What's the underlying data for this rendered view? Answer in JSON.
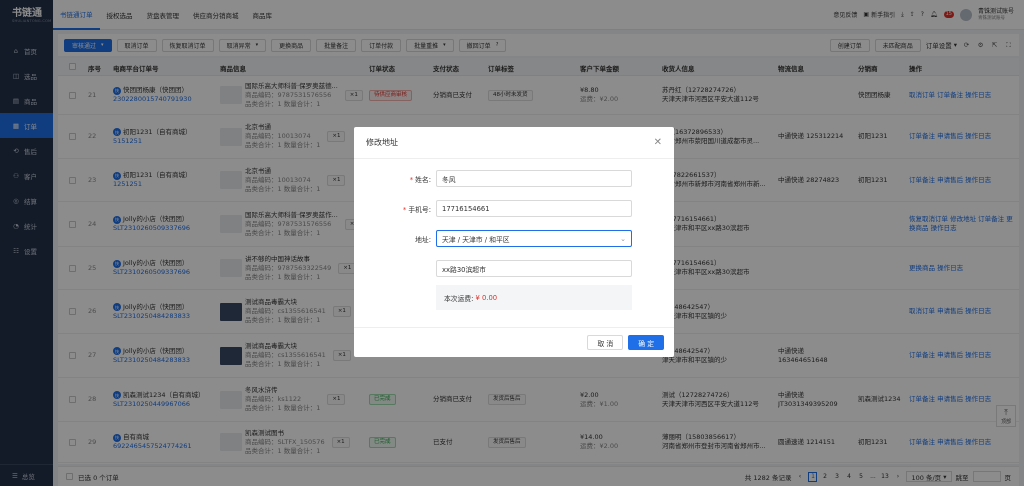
{
  "brand": {
    "title": "书链通",
    "subtitle": "SHULIANTONG.COM"
  },
  "sidebar": {
    "items": [
      {
        "label": "首页",
        "icon": "home-icon"
      },
      {
        "label": "选品",
        "icon": "select-icon"
      },
      {
        "label": "商品",
        "icon": "product-icon"
      },
      {
        "label": "订单",
        "icon": "order-icon",
        "active": true
      },
      {
        "label": "售后",
        "icon": "aftersale-icon"
      },
      {
        "label": "客户",
        "icon": "customer-icon"
      },
      {
        "label": "结算",
        "icon": "settle-icon"
      },
      {
        "label": "统计",
        "icon": "stats-icon"
      },
      {
        "label": "设置",
        "icon": "settings-icon"
      }
    ],
    "bottom": "总览"
  },
  "tabs": [
    "书链通订单",
    "授权选品",
    "货盘表管理",
    "供应商分销商城",
    "商品库"
  ],
  "header": {
    "feedback": "意见反馈",
    "guide": "新手指引",
    "badge": "15",
    "user_name": "青铢测试账号",
    "user_sub": "青铢测试账号"
  },
  "toolbar": {
    "buttons": [
      "审核通过",
      "取消订单",
      "恢复取消订单",
      "取消异常",
      "更换商品",
      "批量备注",
      "订单付款",
      "批量重推",
      "撤回订单"
    ],
    "right": [
      "创建订单",
      "未匹配商品",
      "订单设置"
    ]
  },
  "columns": [
    "序号",
    "电商平台订单号",
    "商品信息",
    "订单状态",
    "支付状态",
    "订单标签",
    "客户下单金额",
    "收货人信息",
    "物流信息",
    "分销商",
    "操作"
  ],
  "rows": [
    {
      "no": "21",
      "store": "快团团杨康（快团团）",
      "order": "2302280015740791930",
      "product": "国际乐高大师科普·保罗奥兹德...",
      "code": "商品编码：9787531576556",
      "qty": "品类合计：1   数量合计：1",
      "status": "待供应商审核",
      "status_type": "red",
      "pay": "分销商已支付",
      "tag": "48小时未发货",
      "amount": "¥8.80",
      "amount2": "运费：¥2.00",
      "receiver": "苏丹红（12728274726）",
      "addr": "天津天津市河西区平安大道112号",
      "logistics": "",
      "dist": "快团团杨康",
      "ops": "取消订单 订单备注 操作日志"
    },
    {
      "no": "22",
      "store": "初阳1231（自有商城）",
      "order": "5151251",
      "product": "北京书通",
      "code": "商品编码：10013074",
      "qty": "品类合计：1   数量合计：1",
      "status": "",
      "status_type": "",
      "pay": "",
      "tag": "",
      "amount": "",
      "amount2": "",
      "receiver": "东（16372896533）",
      "addr": "北省郑州市荥阳国川道成都市灵...",
      "logistics": "中通快递 125312214",
      "dist": "初阳1231",
      "ops": "订单备注 申请售后 操作日志"
    },
    {
      "no": "23",
      "store": "初阳1231（自有商城）",
      "order": "1251251",
      "product": "北京书通",
      "code": "商品编码：10013074",
      "qty": "品类合计：1   数量合计：1",
      "status": "",
      "status_type": "",
      "pay": "",
      "tag": "",
      "amount": "",
      "amount2": "",
      "receiver": "（17822661537）",
      "addr": "北省郑州市新郑市河南省郑州市新...",
      "logistics": "中通快递 28274823",
      "dist": "初阳1231",
      "ops": "订单备注 申请售后 操作日志"
    },
    {
      "no": "24",
      "store": "Jolly的小店（快团团）",
      "order": "SLT2310260509337696",
      "product": "国际乐高大师科普·保罗奥兹作...",
      "code": "商品编码：9787531576556",
      "qty": "品类合计：1   数量合计：1",
      "status": "",
      "status_type": "",
      "pay": "",
      "tag": "",
      "amount": "",
      "amount2": "",
      "receiver": "（17716154661）",
      "addr": "津天津市和平区xx路30滨超市",
      "logistics": "",
      "dist": "",
      "ops": "恢复取消订单 修改地址 订单备注 更换商品 操作日志"
    },
    {
      "no": "25",
      "store": "Jolly的小店（快团团）",
      "order": "SLT2310260509337696",
      "product": "讲不够的中国神话故事",
      "code": "商品编码：9787563322549",
      "qty": "品类合计：1   数量合计：1",
      "status": "",
      "status_type": "",
      "pay": "",
      "tag": "",
      "amount": "",
      "amount2": "",
      "receiver": "（17716154661）",
      "addr": "津天津市和平区xx路30滨超市",
      "logistics": "",
      "dist": "",
      "ops": "更换商品 操作日志"
    },
    {
      "no": "26",
      "store": "Jolly的小店（快团团）",
      "order": "SLT2310250484283833",
      "product": "测试商品毒霸大块",
      "code": "商品编码：cs1355616541",
      "qty": "品类合计：1   数量合计：1",
      "status": "",
      "status_type": "",
      "pay": "",
      "tag": "",
      "amount": "",
      "amount2": "",
      "receiver": "15348642547）",
      "addr": "津天津市和平区镇的少",
      "logistics": "",
      "dist": "",
      "ops": "取消订单 申请售后 操作日志"
    },
    {
      "no": "27",
      "store": "Jolly的小店（快团团）",
      "order": "SLT2310250484283833",
      "product": "测试商品毒霸大块",
      "code": "商品编码：cs1355616541",
      "qty": "品类合计：1   数量合计：1",
      "status": "",
      "status_type": "",
      "pay": "",
      "tag": "",
      "amount": "",
      "amount2": "",
      "receiver": "15348642547）",
      "addr": "津天津市和平区镇的少",
      "logistics": "中通快递 163464651648",
      "dist": "",
      "ops": "订单备注 申请售后 操作日志"
    },
    {
      "no": "28",
      "store": "凯森测试1234（自有商城）",
      "order": "SLT2310250449967066",
      "product": "冬风水浒传",
      "code": "商品编码：ks1122",
      "qty": "品类合计：1   数量合计：1",
      "status": "已完成",
      "status_type": "green",
      "pay": "分销商已支付",
      "tag": "发货后售后",
      "amount": "¥2.00",
      "amount2": "运费：¥1.00",
      "receiver": "测试（12728274726）",
      "addr": "天津天津市河西区平安大道112号",
      "logistics": "中通快递 JT3031349395209",
      "dist": "凯森测试1234",
      "ops": "订单备注 申请售后 操作日志"
    },
    {
      "no": "29",
      "store": "自有商城",
      "order": "6922465457524774261",
      "product": "凯森测试图书",
      "code": "商品编码：SLTFX_150576",
      "qty": "品类合计：1   数量合计：1",
      "status": "已完成",
      "status_type": "green",
      "pay": "已支付",
      "tag": "发货后售后",
      "amount": "¥14.00",
      "amount2": "运费：¥2.00",
      "receiver": "薄丽明（15803856617）",
      "addr": "河南省郑州市登封市河南省郑州市...",
      "logistics": "圆通速递 1214151",
      "dist": "初阳1231",
      "ops": "订单备注 申请售后 操作日志"
    }
  ],
  "footer": {
    "selected": "已选 0 个订单",
    "total": "共 1282 条记录",
    "pages": [
      "1",
      "2",
      "3",
      "4",
      "5",
      "...",
      "13"
    ],
    "page_size": "100 条/页",
    "jump_label": "跳至",
    "jump_unit": "页"
  },
  "backtop": "顶部",
  "modal": {
    "title": "修改地址",
    "name_label": "姓名:",
    "name_value": "冬风",
    "phone_label": "手机号:",
    "phone_value": "17716154661",
    "addr_label": "地址:",
    "region_value": "天津 / 天津市 / 和平区",
    "detail_value": "xx路30滨超市",
    "fee_label": "本次运费:",
    "fee_value": "¥ 0.00",
    "cancel": "取 消",
    "ok": "确 定"
  }
}
